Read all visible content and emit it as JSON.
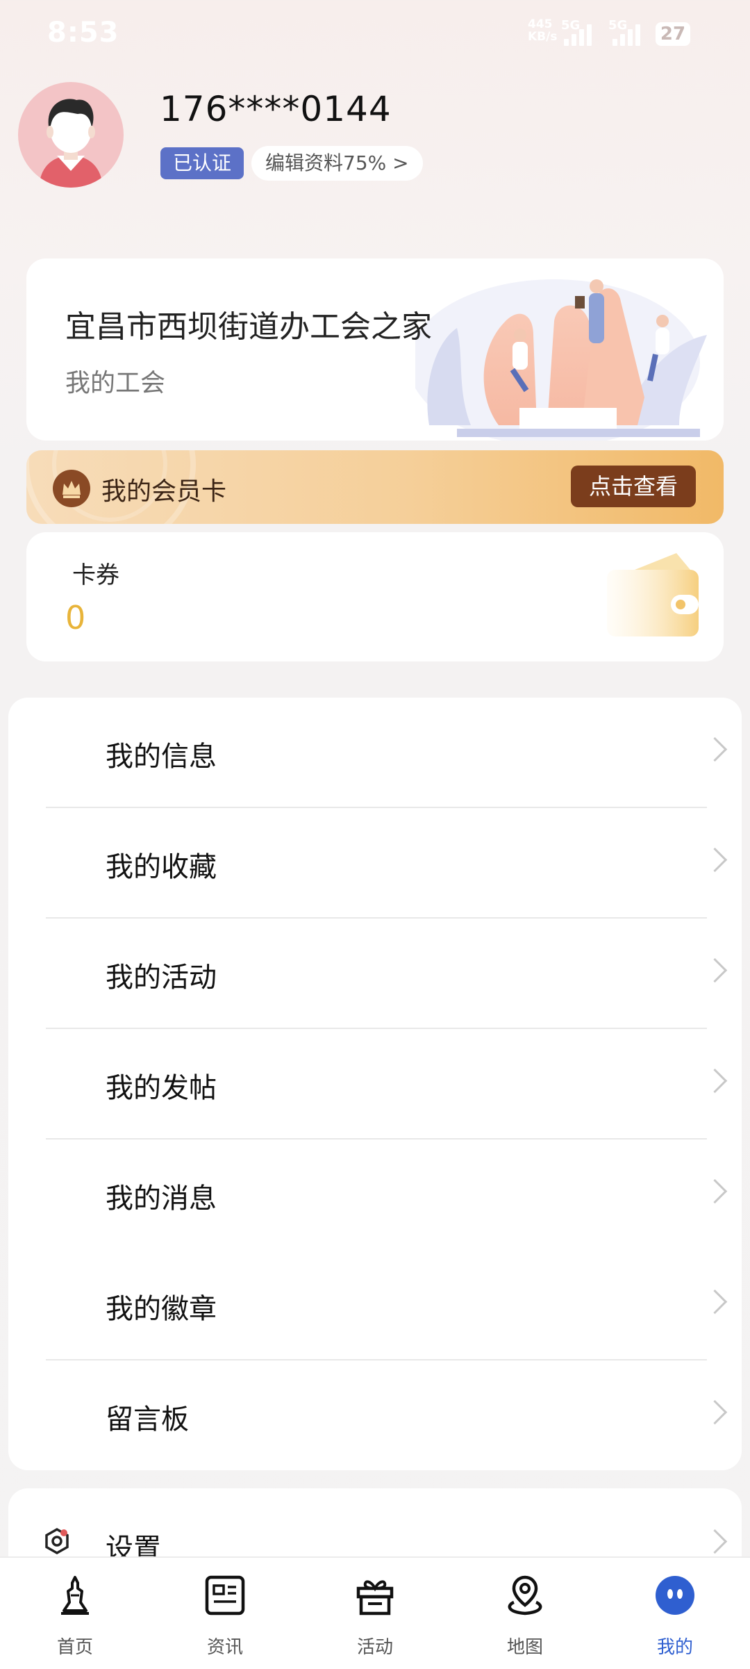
{
  "status_bar": {
    "time": "8:53",
    "net_speed_top": "445",
    "net_speed_bottom": "KB/s",
    "net_type_1": "5G",
    "net_type_2": "5G",
    "battery": "27"
  },
  "profile": {
    "phone": "176****0144",
    "verified_label": "已认证",
    "edit_label": "编辑资料75%  >"
  },
  "union": {
    "title": "宜昌市西坝街道办工会之家",
    "subtitle": "我的工会"
  },
  "member_card": {
    "label": "我的会员卡",
    "button": "点击查看"
  },
  "coupon": {
    "label": "卡券",
    "value": "0"
  },
  "menu": {
    "items": [
      {
        "label": "我的信息"
      },
      {
        "label": "我的收藏"
      },
      {
        "label": "我的活动"
      },
      {
        "label": "我的发帖"
      },
      {
        "label": "我的消息"
      },
      {
        "label": "我的徽章"
      },
      {
        "label": "留言板"
      }
    ]
  },
  "settings": {
    "label": "设置"
  },
  "bottom_nav": {
    "items": [
      {
        "label": "首页",
        "icon": "home-tower-icon"
      },
      {
        "label": "资讯",
        "icon": "news-icon"
      },
      {
        "label": "活动",
        "icon": "gift-icon"
      },
      {
        "label": "地图",
        "icon": "map-pin-icon"
      },
      {
        "label": "我的",
        "icon": "profile-face-icon",
        "active": true
      }
    ]
  },
  "colors": {
    "accent": "#2f5fd0",
    "verified_bg": "#5c71c7",
    "member_button": "#7b3d1c",
    "coupon_value": "#e8b43a"
  }
}
